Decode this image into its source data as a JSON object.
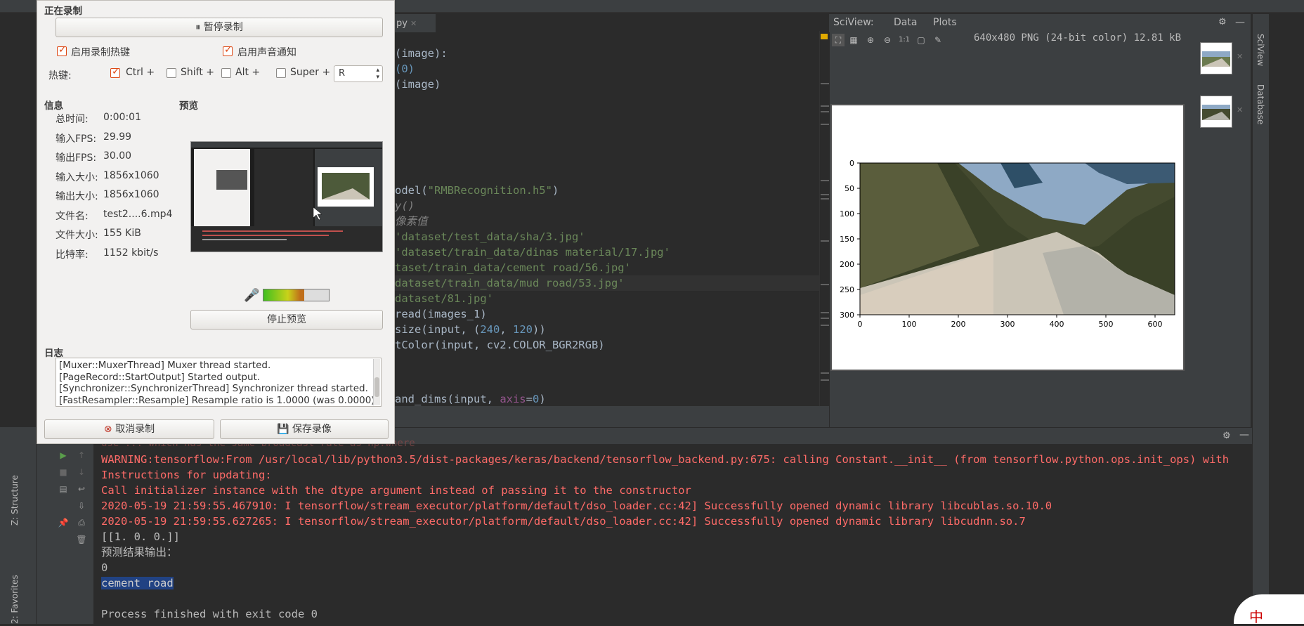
{
  "editor": {
    "tab_label": "py",
    "lines": [
      {
        "y": 76,
        "html": "<span>(image):</span>"
      },
      {
        "y": 98,
        "html": "<span class='num'>(0)</span>"
      },
      {
        "y": 120,
        "html": "<span>(image)</span>"
      },
      {
        "y": 271,
        "html": "<span>odel(</span><span class='str'>\"RMBRecognition.h5\"</span><span>)</span>"
      },
      {
        "y": 293,
        "html": "<span class='cm'>y()</span>"
      },
      {
        "y": 315,
        "html": "<span class='cm'>像素值</span>"
      },
      {
        "y": 337,
        "html": "<span class='str'>'dataset/test_data/sha/3.jpg'</span>"
      },
      {
        "y": 359,
        "html": "<span class='str'>'dataset/train_data/dinas material/17.jpg'</span>"
      },
      {
        "y": 381,
        "html": "<span class='str'>taset/train_data/cement road/56.jpg'</span>"
      },
      {
        "y": 403,
        "html": "<span class='str'>dataset/train_data/mud road/53.jpg'</span>"
      },
      {
        "y": 425,
        "html": "<span class='str'>dataset/81.jpg'</span>"
      },
      {
        "y": 447,
        "html": "<span>read(images_1)</span>"
      },
      {
        "y": 469,
        "html": "<span>size(input, (</span><span class='num'>240</span><span>, </span><span class='num'>120</span><span>))</span>"
      },
      {
        "y": 491,
        "html": "<span>tColor(input, cv2.COLOR_BGR2RGB)</span>"
      },
      {
        "y": 568,
        "html": "<span>and_dims(input, </span><span class='kw'>axis</span><span>=</span><span class='num'>0</span><span>)</span>"
      }
    ]
  },
  "sciview": {
    "title": "SciView:",
    "tab_data": "Data",
    "tab_plots": "Plots",
    "image_info": "640x480 PNG (24-bit color) 12.81 kB",
    "side_label": "SciView",
    "db_label": "Database"
  },
  "chart_data": {
    "type": "image",
    "x_ticks": [
      "0",
      "100",
      "200",
      "300",
      "400",
      "500",
      "600"
    ],
    "y_ticks": [
      "0",
      "50",
      "100",
      "150",
      "200",
      "250",
      "300"
    ]
  },
  "console": {
    "lines": [
      {
        "cls": "red",
        "text": "WARNING:tensorflow:From /usr/local/lib/python3.5/dist-packages/keras/backend/tensorflow_backend.py:675: calling Constant.__init__ (from tensorflow.python.ops.init_ops) with"
      },
      {
        "cls": "red",
        "text": "Instructions for updating:"
      },
      {
        "cls": "red",
        "text": "Call initializer instance with the dtype argument instead of passing it to the constructor"
      },
      {
        "cls": "red",
        "text": "2020-05-19 21:59:55.467910: I tensorflow/stream_executor/platform/default/dso_loader.cc:42] Successfully opened dynamic library libcublas.so.10.0"
      },
      {
        "cls": "red",
        "text": "2020-05-19 21:59:55.627265: I tensorflow/stream_executor/platform/default/dso_loader.cc:42] Successfully opened dynamic library libcudnn.so.7"
      },
      {
        "cls": "wht",
        "text": "[[1. 0. 0.]]"
      },
      {
        "cls": "wht",
        "text": "预测结果输出："
      },
      {
        "cls": "wht",
        "text": "0"
      },
      {
        "cls": "sel",
        "text": "cement road"
      },
      {
        "cls": "wht",
        "text": ""
      },
      {
        "cls": "wht",
        "text": "Process finished with exit code 0"
      }
    ],
    "partial_line": "use ... which has the same broadcast rate as np.where"
  },
  "left_strip": {
    "structure": "Z: Structure",
    "favorites": "2: Favorites"
  },
  "recorder": {
    "title": "正在录制",
    "pause_button": "暂停录制",
    "hotkey_enable": "启用录制热键",
    "sound_notify": "启用声音通知",
    "hotkey_label": "热键:",
    "ctrl": "Ctrl +",
    "shift": "Shift +",
    "alt": "Alt +",
    "super": "Super +",
    "key_value": "R",
    "info_heading": "信息",
    "preview_heading": "预览",
    "info": [
      {
        "label": "总时间:",
        "value": "0:00:01"
      },
      {
        "label": "输入FPS:",
        "value": "29.99"
      },
      {
        "label": "输出FPS:",
        "value": "30.00"
      },
      {
        "label": "输入大小:",
        "value": "1856x1060"
      },
      {
        "label": "输出大小:",
        "value": "1856x1060"
      },
      {
        "label": "文件名:",
        "value": "test2....6.mp4"
      },
      {
        "label": "文件大小:",
        "value": "155 KiB"
      },
      {
        "label": "比特率:",
        "value": "1152 kbit/s"
      }
    ],
    "stop_preview": "停止预览",
    "log_heading": "日志",
    "log": [
      "[Muxer::MuxerThread] Muxer thread started.",
      "[PageRecord::StartOutput] Started output.",
      "[Synchronizer::SynchronizerThread] Synchronizer thread started.",
      "[FastResampler::Resample] Resample ratio is 1.0000 (was 0.0000)."
    ],
    "cancel_button": "取消录制",
    "save_button": "保存录像",
    "audio_level": 0.62
  },
  "ime": {
    "label": "中"
  }
}
